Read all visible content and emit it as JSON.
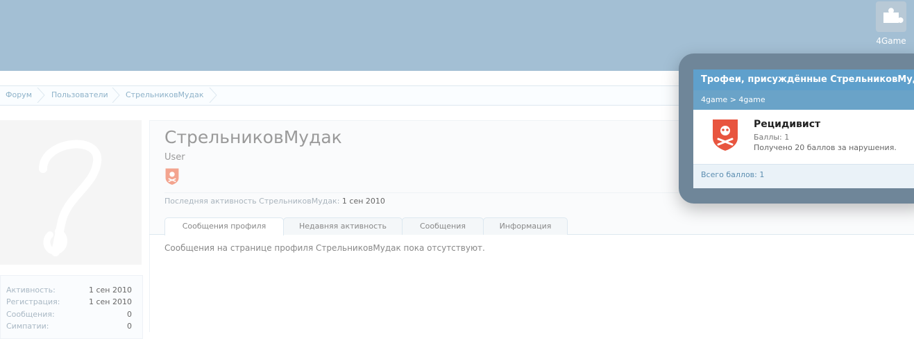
{
  "header": {
    "brand_label": "4Game"
  },
  "breadcrumb": [
    "Форум",
    "Пользователи",
    "СтрельниковМудак"
  ],
  "profile": {
    "username": "СтрельниковМудак",
    "user_title": "User",
    "last_activity_label": "Последняя активность СтрельниковМудак:",
    "last_activity_date": "1 сен 2010",
    "tabs": [
      "Сообщения профиля",
      "Недавняя активность",
      "Сообщения",
      "Информация"
    ],
    "empty_message": "Сообщения на странице профиля СтрельниковМудак пока отсутствуют."
  },
  "stats": [
    {
      "label": "Активность:",
      "value": "1 сен 2010"
    },
    {
      "label": "Регистрация:",
      "value": "1 сен 2010"
    },
    {
      "label": "Сообщения:",
      "value": "0"
    },
    {
      "label": "Симпатии:",
      "value": "0"
    }
  ],
  "overlay": {
    "title": "Трофеи, присуждённые СтрельниковМудак",
    "subtitle": "4game > 4game",
    "trophy": {
      "name": "Рецидивист",
      "points": "Баллы: 1",
      "description": "Получено 20 баллов за нарушения."
    },
    "total": "Всего баллов: 1"
  },
  "colors": {
    "header": "#a3bfd4",
    "accent": "#5fa0cc",
    "badge": "#e8553f"
  },
  "icons": {
    "brand": "puzzle-icon",
    "trophy": "skull-crossbones-icon",
    "avatar": "question-mark-icon"
  }
}
